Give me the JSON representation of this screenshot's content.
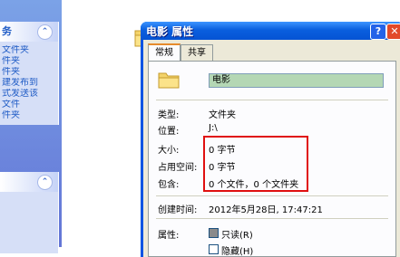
{
  "sidebar": {
    "group1": {
      "title": "务",
      "items": [
        "文件夹",
        "件夹",
        "件夹",
        "建发布到",
        "",
        "式发送该",
        "文件",
        "件夹"
      ]
    },
    "group2": {
      "title": ""
    }
  },
  "file_area": {
    "folder_name": "电影"
  },
  "dialog": {
    "title": "电影 属性",
    "help_label": "?",
    "close_label": "✕",
    "tabs": [
      "常规",
      "共享"
    ],
    "name_value": "电影",
    "fields": {
      "type": {
        "label": "类型:",
        "value": "文件夹"
      },
      "location": {
        "label": "位置:",
        "value": "J:\\"
      },
      "size": {
        "label": "大小:",
        "value": "0 字节"
      },
      "size_on_disk": {
        "label": "占用空间:",
        "value": "0 字节"
      },
      "contains": {
        "label": "包含:",
        "value": "0 个文件，0 个文件夹"
      },
      "created": {
        "label": "创建时间:",
        "value": "2012年5月28日, 17:47:21"
      },
      "attributes": {
        "label": "属性:"
      }
    },
    "attributes": [
      {
        "label": "只读(R)",
        "checked": true
      },
      {
        "label": "隐藏(H)",
        "checked": false
      }
    ]
  },
  "colors": {
    "highlight_border": "#e01010",
    "titlebar": "#0a5fde",
    "task_pane": "#6375d6"
  }
}
